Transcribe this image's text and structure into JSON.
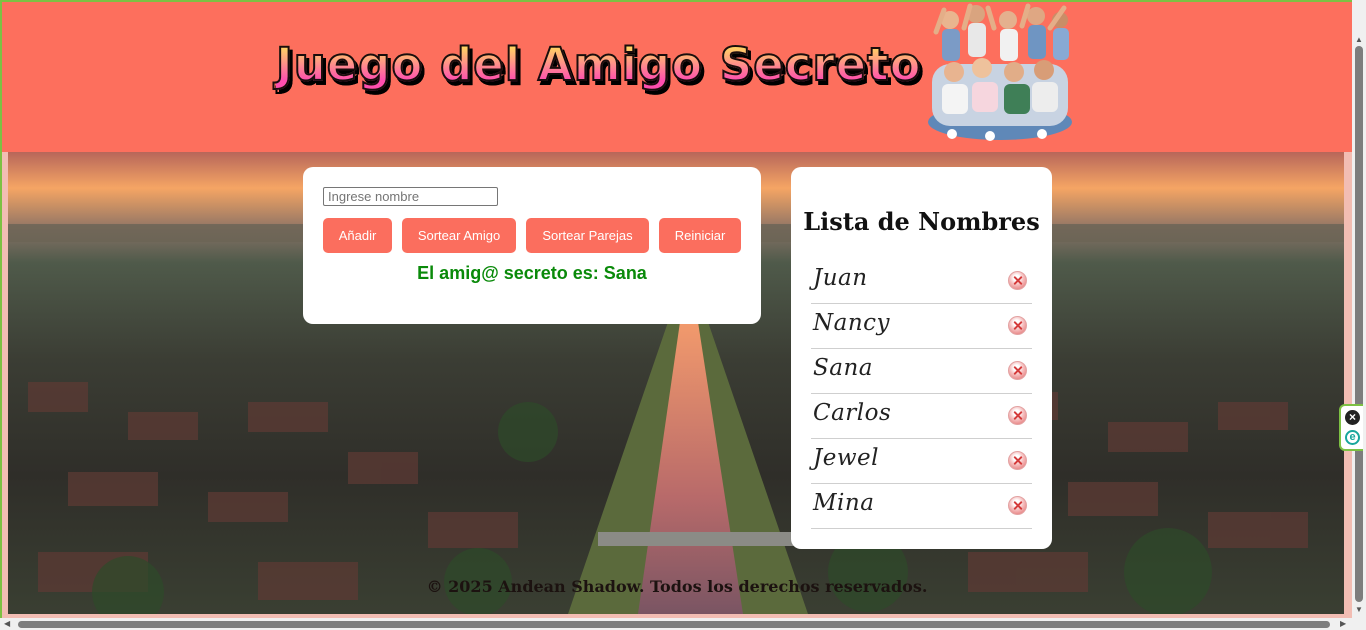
{
  "header": {
    "title": "Juego del Amigo Secreto",
    "background_color": "#fd6f5d",
    "image": "kids-group-photo"
  },
  "form": {
    "name_input": {
      "placeholder": "Ingrese nombre",
      "value": ""
    },
    "buttons": {
      "add": "Añadir",
      "draw_friend": "Sortear Amigo",
      "draw_pairs": "Sortear Parejas",
      "reset": "Reiniciar"
    },
    "button_color": "#fb6e5e",
    "result": "El amig@ secreto es: Sana",
    "result_color": "#0a8a0a"
  },
  "list": {
    "title": "Lista de Nombres",
    "names": [
      "Juan",
      "Nancy",
      "Sana",
      "Carlos",
      "Jewel",
      "Mina"
    ],
    "delete_icon": "delete-icon"
  },
  "footer": {
    "text": "© 2025 Andean Shadow. Todos los derechos reservados."
  },
  "browser_extension": {
    "close_icon": "close-icon",
    "icon": "e-extension-icon"
  }
}
